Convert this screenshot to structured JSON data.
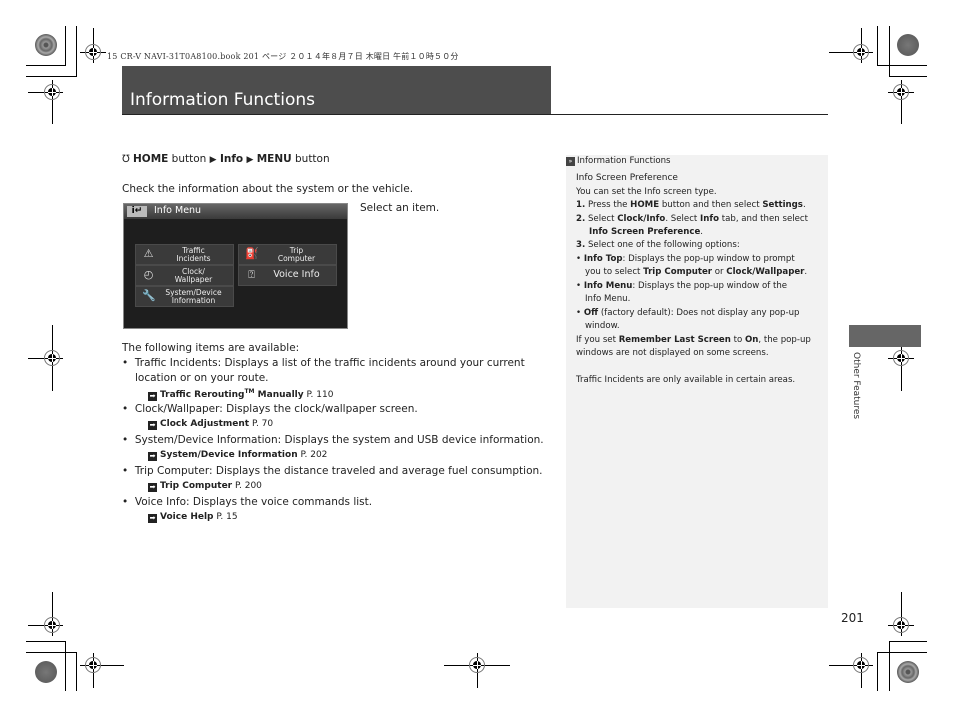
{
  "print_header": "15 CR-V NAVI-31T0A8100.book  201 ページ  ２０１４年８月７日  木曜日  午前１０時５０分",
  "page_title": "Information Functions",
  "nav_path": {
    "icon": "voice-icon",
    "items": [
      {
        "bold": "HOME",
        "rest": " button"
      },
      {
        "bold": "Info",
        "rest": ""
      },
      {
        "bold": "MENU",
        "rest": " button"
      }
    ],
    "separator": "▶"
  },
  "intro": "Check the information about the system or the vehicle.",
  "screen": {
    "title": "Info Menu",
    "buttons": [
      {
        "label_line1": "Traffic",
        "label_line2": "Incidents",
        "icon": "traffic-icon"
      },
      {
        "label_line1": "Trip",
        "label_line2": "Computer",
        "icon": "fuel-icon"
      },
      {
        "label_line1": "Clock/",
        "label_line2": "Wallpaper",
        "icon": "clock-icon"
      },
      {
        "label_line1": "Voice Info",
        "label_line2": "",
        "icon": "voice-info-icon"
      },
      {
        "label_line1": "System/Device",
        "label_line2": "Information",
        "icon": "wrench-icon"
      }
    ]
  },
  "screen_caption": "Select an item.",
  "items_intro": "The following items are available:",
  "items": [
    {
      "name": "Traffic Incidents",
      "desc": ": Displays a list of the traffic incidents around your current",
      "desc2": "location or on your route.",
      "ref_bold": "Traffic Rerouting",
      "ref_sup": "TM",
      "ref_bold2": " Manually",
      "ref_page": " P. 110"
    },
    {
      "name": "Clock/Wallpaper",
      "desc": ": Displays the clock/wallpaper screen.",
      "ref_bold": "Clock Adjustment",
      "ref_page": " P. 70"
    },
    {
      "name": "System/Device Information",
      "desc": ": Displays the system and USB device information.",
      "ref_bold": "System/Device Information",
      "ref_page": " P. 202"
    },
    {
      "name": "Trip Computer",
      "desc": ": Displays the distance traveled and average fuel consumption.",
      "ref_bold": "Trip Computer",
      "ref_page": " P. 200"
    },
    {
      "name": "Voice Info",
      "desc": ": Displays the voice commands list.",
      "ref_bold": "Voice Help",
      "ref_page": " P. 15"
    }
  ],
  "sidebar": {
    "header": "Information Functions",
    "heading": "Info Screen Preference",
    "intro": "You can set the Info screen type.",
    "step1": {
      "num": "1.",
      "a": " Press the ",
      "b1": "HOME",
      "c": " button and then select ",
      "b2": "Settings",
      "d": "."
    },
    "step2": {
      "num": "2.",
      "a": " Select ",
      "b1": "Clock/Info",
      "c": ". Select ",
      "b2": "Info",
      "d": " tab, and then select",
      "b3": "Info Screen Preference",
      "e": "."
    },
    "step3": {
      "num": "3.",
      "a": " Select one of the following options:"
    },
    "opt1": {
      "b": "Info Top",
      "a": ": Displays the pop-up window to prompt",
      "l2a": "you to select ",
      "l2b1": "Trip Computer",
      "l2c": " or ",
      "l2b2": "Clock/Wallpaper",
      "l2d": "."
    },
    "opt2": {
      "b": "Info Menu",
      "a": ": Displays the pop-up window of the",
      "l2": "Info Menu."
    },
    "opt3": {
      "b": "Off",
      "a": " (factory default): Does not display any pop-up",
      "l2": "window."
    },
    "note1": {
      "a": "If you set ",
      "b1": "Remember Last Screen",
      "c": " to ",
      "b2": "On",
      "d": ", the pop-up",
      "l2": "windows are not displayed on some screens."
    },
    "note2": "Traffic Incidents are only available in certain areas."
  },
  "section_tab": "Other Features",
  "page_number": "201"
}
